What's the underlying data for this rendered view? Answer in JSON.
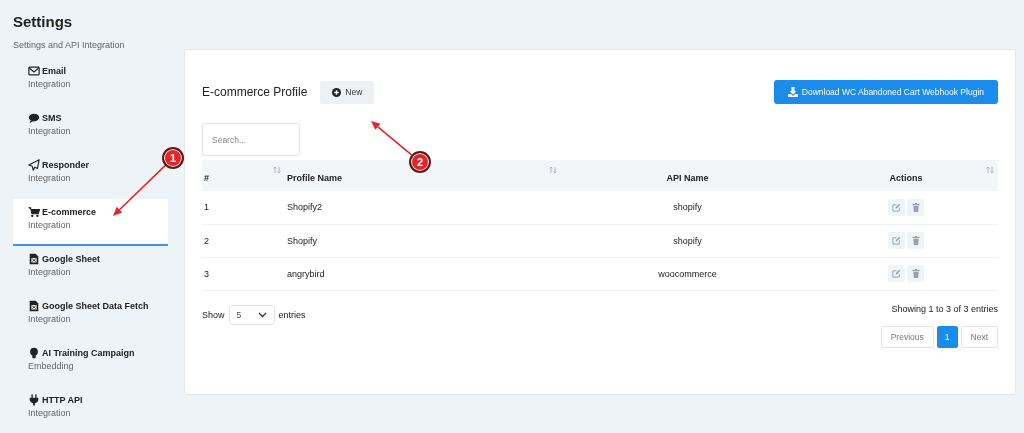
{
  "page": {
    "title": "Settings",
    "subtitle": "Settings and API Integration"
  },
  "sidebar": {
    "items": [
      {
        "title": "Email",
        "subtitle": "Integration",
        "selected": false
      },
      {
        "title": "SMS",
        "subtitle": "Integration",
        "selected": false
      },
      {
        "title": "Responder",
        "subtitle": "Integration",
        "selected": false
      },
      {
        "title": "E-commerce",
        "subtitle": "Integration",
        "selected": true
      },
      {
        "title": "Google Sheet",
        "subtitle": "Integration",
        "selected": false
      },
      {
        "title": "Google Sheet Data Fetch",
        "subtitle": "Integration",
        "selected": false
      },
      {
        "title": "AI Training Campaign",
        "subtitle": "Embedding",
        "selected": false
      },
      {
        "title": "HTTP API",
        "subtitle": "Integration",
        "selected": false
      }
    ]
  },
  "panel": {
    "title": "E-commerce Profile",
    "new_button": "New",
    "download_button": "Download WC Abandoned Cart Webhook Plugin",
    "search": {
      "placeholder": "Search..."
    },
    "table": {
      "columns": [
        {
          "label": "#",
          "sortable": true
        },
        {
          "label": "Profile Name",
          "sortable": true
        },
        {
          "label": "API Name",
          "sortable": false
        },
        {
          "label": "Actions",
          "sortable": true
        }
      ],
      "rows": [
        {
          "num": "1",
          "profile": "Shopify2",
          "api": "shopify"
        },
        {
          "num": "2",
          "profile": "Shopify",
          "api": "shopify"
        },
        {
          "num": "3",
          "profile": "angrybird",
          "api": "woocommerce"
        }
      ]
    },
    "length": {
      "before": "Show",
      "value": "5",
      "after": "entries"
    },
    "info": "Showing 1 to 3 of 3 entries",
    "pagination": [
      {
        "label": "Previous",
        "selected": false
      },
      {
        "label": "1",
        "selected": true
      },
      {
        "label": "Next",
        "selected": false
      }
    ]
  },
  "annotations": [
    {
      "label": "1"
    },
    {
      "label": "2"
    }
  ]
}
